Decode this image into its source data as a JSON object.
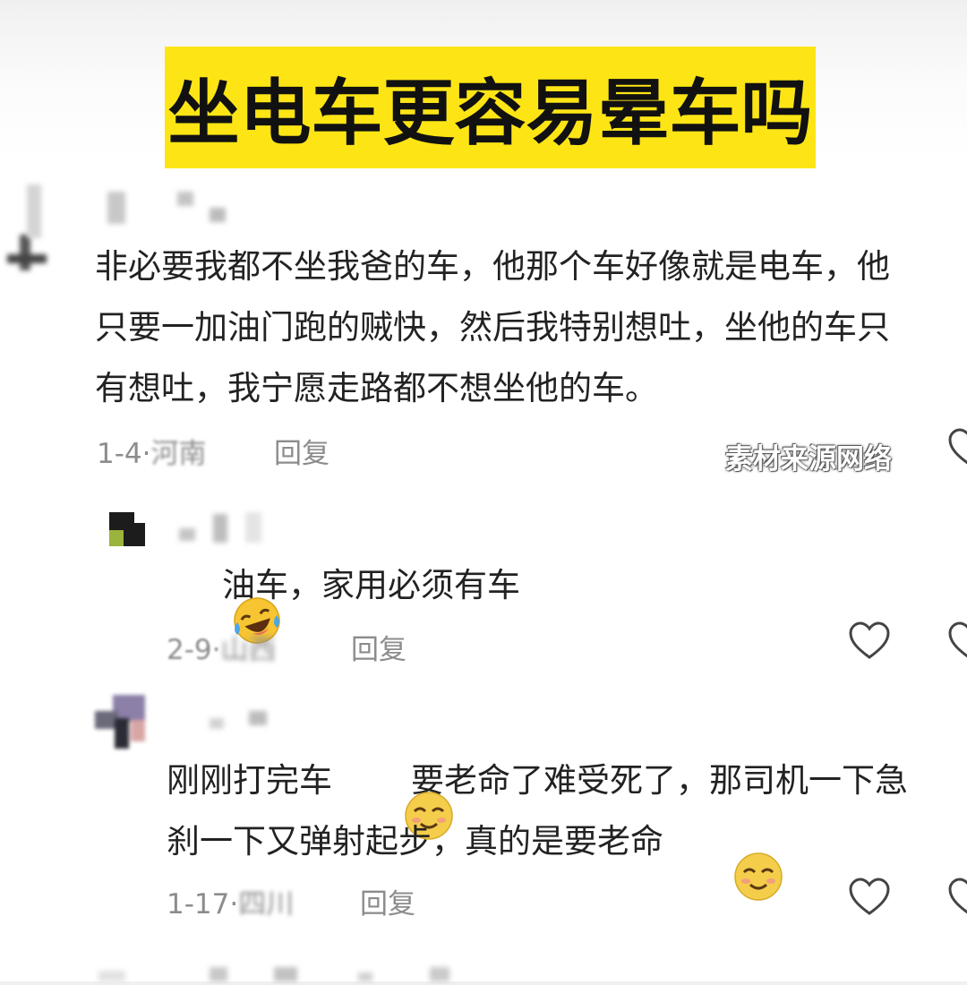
{
  "banner": {
    "title": "坐电车更容易晕车吗"
  },
  "watermark": "素材来源网络",
  "comments": [
    {
      "lines": [
        "非必要我都不坐我爸的车，他那个车好像就是电车，他",
        "只要一加油门跑的贼快，然后我特别想吐，坐他的车只",
        "有想吐，我宁愿走路都不想坐他的车。"
      ],
      "date": "1-4·",
      "location": "河南",
      "reply_label": "回复"
    },
    {
      "text": "油车，家用必须有车",
      "emoji": "laughing-tears-emoji",
      "date": "2-9·",
      "location": "山西",
      "reply_label": "回复"
    },
    {
      "line1_a": "刚刚打完车",
      "line1_b": "要老命了难受死了，那司机一下急",
      "line2": "刹一下又弹射起步，真的是要老命",
      "emoji": "smiling-face-emoji",
      "date": "1-17·",
      "location": "四川",
      "reply_label": "回复"
    }
  ],
  "icons": {
    "like": "heart-outline-icon"
  },
  "colors": {
    "banner": "#fde515",
    "meta_text": "#8c8c8c",
    "body_text": "#222222"
  }
}
